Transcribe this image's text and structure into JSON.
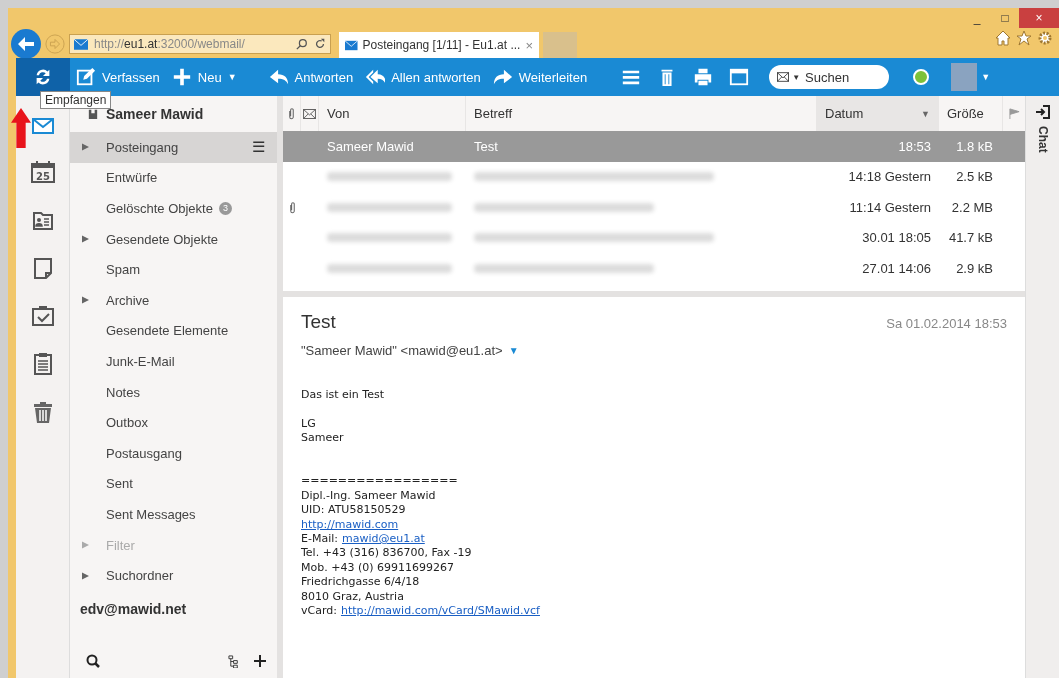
{
  "browser": {
    "url": "http://**eu1.at**:32000/webmail/",
    "tab": {
      "title": "Posteingang [1/11] - Eu1.at ...",
      "close": "×"
    },
    "caption_buttons": [
      "_",
      "□",
      "×"
    ]
  },
  "toolbar": {
    "items": [
      {
        "kind": "icon",
        "selected": true
      },
      {
        "kind": "button",
        "label": "Verfassen"
      },
      {
        "kind": "dropdown",
        "label": "Neu",
        "caret": "▼"
      },
      {
        "kind": "button",
        "label": "Antworten"
      },
      {
        "kind": "button",
        "label": "Allen antworten"
      },
      {
        "kind": "button",
        "label": "Weiterleiten"
      },
      {
        "kind": "icon",
        "selected": false
      },
      {
        "kind": "icon",
        "selected": false
      },
      {
        "kind": "icon",
        "selected": false
      },
      {
        "kind": "icon",
        "selected": false
      }
    ],
    "search": {
      "scope_caret": "▼",
      "placeholder": "Suchen"
    },
    "status": {
      "color": "#7dc13a"
    },
    "user_caret": "▼"
  },
  "tooltip": "Empfangen",
  "calendar_day": "25",
  "account": "Sameer Mawid",
  "folders": [
    {
      "label": "Posteingang",
      "expandable": true,
      "selected": true,
      "disabled": false,
      "menu": "☰"
    },
    {
      "label": "Entwürfe",
      "expandable": false,
      "selected": false,
      "disabled": false
    },
    {
      "label": "Gelöschte Objekte",
      "expandable": false,
      "selected": false,
      "disabled": false,
      "badge": "3"
    },
    {
      "label": "Gesendete Objekte",
      "expandable": true,
      "selected": false,
      "disabled": false
    },
    {
      "label": "Spam",
      "expandable": false,
      "selected": false,
      "disabled": false
    },
    {
      "label": "Archive",
      "expandable": true,
      "selected": false,
      "disabled": false
    },
    {
      "label": "Gesendete Elemente",
      "expandable": false,
      "selected": false,
      "disabled": false
    },
    {
      "label": "Junk-E-Mail",
      "expandable": false,
      "selected": false,
      "disabled": false
    },
    {
      "label": "Notes",
      "expandable": false,
      "selected": false,
      "disabled": false
    },
    {
      "label": "Outbox",
      "expandable": false,
      "selected": false,
      "disabled": false
    },
    {
      "label": "Postausgang",
      "expandable": false,
      "selected": false,
      "disabled": false
    },
    {
      "label": "Sent",
      "expandable": false,
      "selected": false,
      "disabled": false
    },
    {
      "label": "Sent Messages",
      "expandable": false,
      "selected": false,
      "disabled": false
    },
    {
      "label": "Filter",
      "expandable": true,
      "selected": false,
      "disabled": true
    },
    {
      "label": "Suchordner",
      "expandable": true,
      "selected": false,
      "disabled": false
    }
  ],
  "second_account": "edv@mawid.net",
  "list": {
    "columns": {
      "from": "Von",
      "subject": "Betreff",
      "date": "Datum",
      "date_sort": "▼",
      "size": "Größe"
    },
    "rows": [
      {
        "from": "Sameer Mawid",
        "subject": "Test",
        "date": "18:53",
        "size": "1.8 kB",
        "selected": true,
        "attachment": false,
        "blurred": false
      },
      {
        "date": "14:18 Gestern",
        "size": "2.5 kB",
        "selected": false,
        "attachment": false,
        "blurred": true
      },
      {
        "date": "11:14 Gestern",
        "size": "2.2 MB",
        "selected": false,
        "attachment": true,
        "blurred": true
      },
      {
        "date": "30.01 18:05",
        "size": "41.7 kB",
        "selected": false,
        "attachment": false,
        "blurred": true
      },
      {
        "date": "27.01 14:06",
        "size": "2.9 kB",
        "selected": false,
        "attachment": false,
        "blurred": true
      }
    ]
  },
  "message": {
    "subject": "Test",
    "date": "Sa 01.02.2014 18:53",
    "from": "\"Sameer Mawid\" <mawid@eu1.at>",
    "from_caret": "▼",
    "body": [
      {
        "kind": "text",
        "text": "Das ist ein Test"
      },
      {
        "kind": "blank"
      },
      {
        "kind": "text",
        "text": "LG"
      },
      {
        "kind": "text",
        "text": "Sameer"
      },
      {
        "kind": "blank"
      },
      {
        "kind": "blank"
      },
      {
        "kind": "text",
        "text": "================="
      },
      {
        "kind": "text",
        "text": "Dipl.-Ing. Sameer Mawid"
      },
      {
        "kind": "text",
        "text": "UID: ATU58150529"
      },
      {
        "kind": "link",
        "link": "http://mawid.com"
      },
      {
        "kind": "labeled",
        "text": "E-Mail:",
        "link": "mawid@eu1.at"
      },
      {
        "kind": "text",
        "text": "Tel. +43 (316) 836700, Fax -19"
      },
      {
        "kind": "text",
        "text": "Mob. +43 (0) 69911699267"
      },
      {
        "kind": "text",
        "text": "Friedrichgasse 6/4/18"
      },
      {
        "kind": "text",
        "text": "8010 Graz, Austria"
      },
      {
        "kind": "labeled",
        "text": "vCard:",
        "link": "http://mawid.com/vCard/SMawid.vcf"
      }
    ]
  },
  "chat": "Chat"
}
